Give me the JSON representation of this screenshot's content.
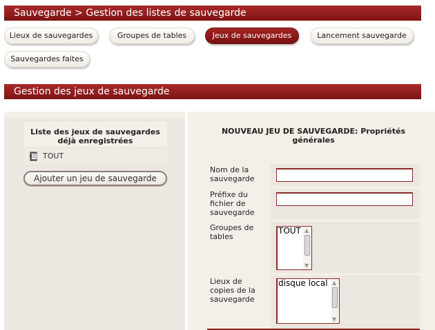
{
  "breadcrumb": "Sauvegarde > Gestion des listes de sauvegarde",
  "nav": {
    "tabs": [
      {
        "label": "Lieux de sauvegardes"
      },
      {
        "label": "Groupes de tables"
      },
      {
        "label": "Jeux de sauvegardes"
      },
      {
        "label": "Lancement sauvegarde"
      },
      {
        "label": "Sauvegardes faites"
      }
    ],
    "active_tab": "Jeux de sauvegardes"
  },
  "section_title": "Gestion des jeux de sauvegarde",
  "left": {
    "header": "Liste des jeux de sauvegardes déjà enregistrées",
    "items": [
      {
        "label": "TOUT",
        "icon": "book-icon"
      }
    ],
    "add_button": "Ajouter un jeu de sauvegarde"
  },
  "form": {
    "header": "NOUVEAU JEU DE SAUVEGARDE: Propriétés générales",
    "name_label": "Nom de la sauvegarde",
    "name_value": "",
    "prefix_label": "Préfixe du fichier de sauvegarde",
    "prefix_value": "",
    "groups_label": "Groupes de tables",
    "groups_options": [
      "TOUT"
    ],
    "locations_label": "Lieux de copies de la sauvegarde",
    "locations_options": [
      "disque local"
    ]
  },
  "colors": {
    "accent": "#8b1a1a",
    "panel": "#f4efe7"
  }
}
